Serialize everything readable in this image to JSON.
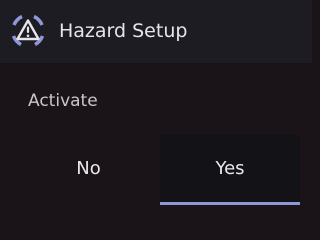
{
  "header": {
    "title": "Hazard Setup",
    "icon": "hazard-warning-icon",
    "icon_color": "#8e98d8"
  },
  "activate": {
    "label": "Activate",
    "options": [
      {
        "label": "No",
        "selected": false
      },
      {
        "label": "Yes",
        "selected": true
      }
    ],
    "accent": "#8e98d8"
  }
}
